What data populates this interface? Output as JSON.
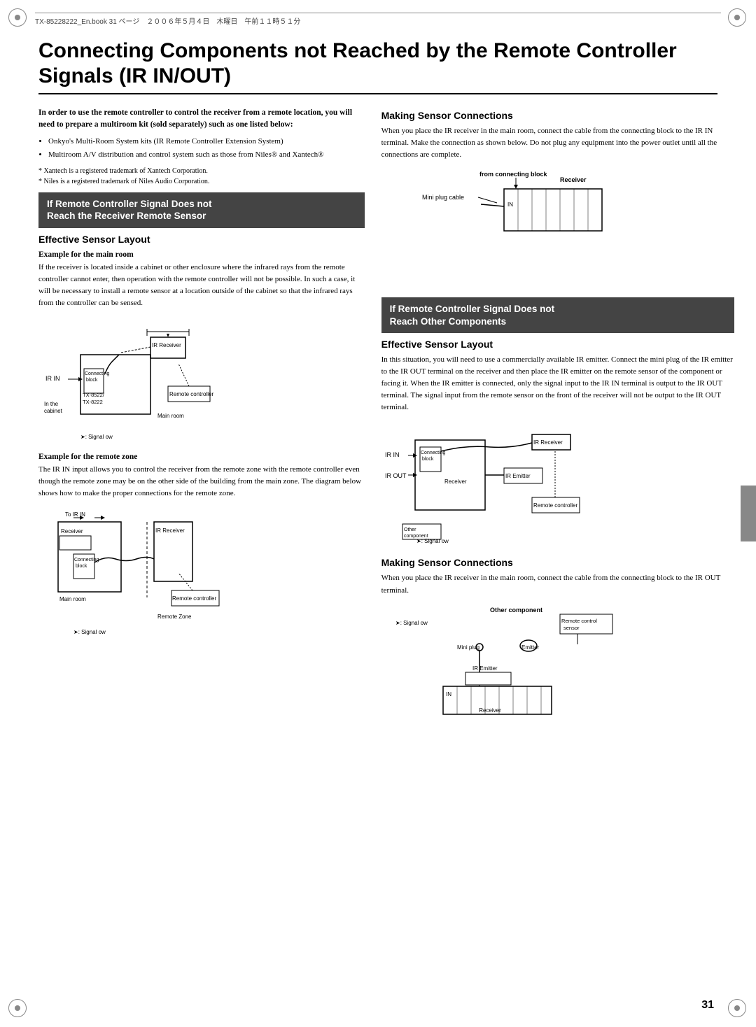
{
  "header": {
    "text": "TX-85228222_En.book 31 ページ　２００６年５月４日　木曜日　午前１１時５１分"
  },
  "page_title": "Connecting Components not Reached by the Remote Controller Signals (IR IN/OUT)",
  "left_column": {
    "intro_bold": "In order to use the remote controller to control the receiver from a remote location, you will need to prepare a multiroom kit (sold separately) such as one listed below:",
    "bullets": [
      "Onkyo's Multi-Room System kits (IR Remote Controller Extension System)",
      "Multiroom A/V distribution and control system such as those from Niles® and Xantech®"
    ],
    "footnotes": [
      "* Xantech is a registered trademark of Xantech Corporation.",
      "* Niles is a registered trademark of Niles Audio Corporation."
    ],
    "section_box_1": {
      "line1": "If Remote Controller Signal Does not",
      "line2": "Reach the Receiver Remote Sensor"
    },
    "sub_heading_1": "Effective Sensor Layout",
    "example_main_room_heading": "Example for the main room",
    "example_main_room_text": "If the receiver is located inside a cabinet or other enclosure where the infrared rays from the remote controller cannot enter, then operation with the remote controller will not be possible. In such a case, it will be necessary to install a remote sensor at a location outside of the cabinet so that the infrared rays from the controller can be sensed.",
    "example_remote_zone_heading": "Example for the remote zone",
    "example_remote_zone_text": "The IR IN input allows you to control the receiver from the remote zone with the remote controller even though the remote zone may be on the other side of the building from the main zone. The diagram below shows how to make the proper connections for the remote zone."
  },
  "right_column": {
    "making_sensor_1_heading": "Making Sensor Connections",
    "making_sensor_1_text": "When you place the IR receiver in the main room, connect the cable from the connecting block to the IR IN terminal. Make the connection as shown below. Do not plug any equipment into the power outlet until all the connections are complete.",
    "section_box_2": {
      "line1": "If Remote Controller Signal Does not",
      "line2": "Reach Other Components"
    },
    "sub_heading_2": "Effective Sensor Layout",
    "effective_text": "In this situation, you will need to use a commercially available IR emitter. Connect the mini plug of the IR emitter to the IR OUT terminal on the receiver and then place the IR emitter on the remote sensor of the component or facing it. When the IR emitter is connected, only the signal input to the IR IN terminal is output to the IR OUT terminal. The signal input from the remote sensor on the front of the receiver will not be output to the IR OUT terminal.",
    "making_sensor_2_heading": "Making Sensor Connections",
    "making_sensor_2_text": "When you place the IR receiver in the main room, connect the cable from the connecting block to the IR OUT terminal."
  },
  "diagram_labels": {
    "from_connecting_block": "from connecting block",
    "mini_plug_cable": "Mini plug cable",
    "receiver": "Receiver",
    "ir_in": "IR IN",
    "ir_out": "IR OUT",
    "connecting_block": "Connecting\nblock",
    "ir_receiver": "IR Receiver",
    "tx_8522": "TX-8522/\nTX-8222",
    "in_the_cabinet": "In the\ncabinet",
    "main_room": "Main room",
    "remote_controller": "Remote controller",
    "signal_flow": "➤: Signal  ow",
    "to_ir_in": "To IR IN",
    "receiver_lbl": "Receiver",
    "remote_zone": "Remote Zone",
    "ir_emitter": "IR Emitter",
    "other_component": "Other\ncomponent",
    "other_component2": "Other component",
    "mini_plug": "Mini plug",
    "emitter": "Emitter",
    "ir_emitter2": "IR Emitter",
    "remote_control_sensor": "Remote control\nsensor"
  },
  "page_number": "31"
}
